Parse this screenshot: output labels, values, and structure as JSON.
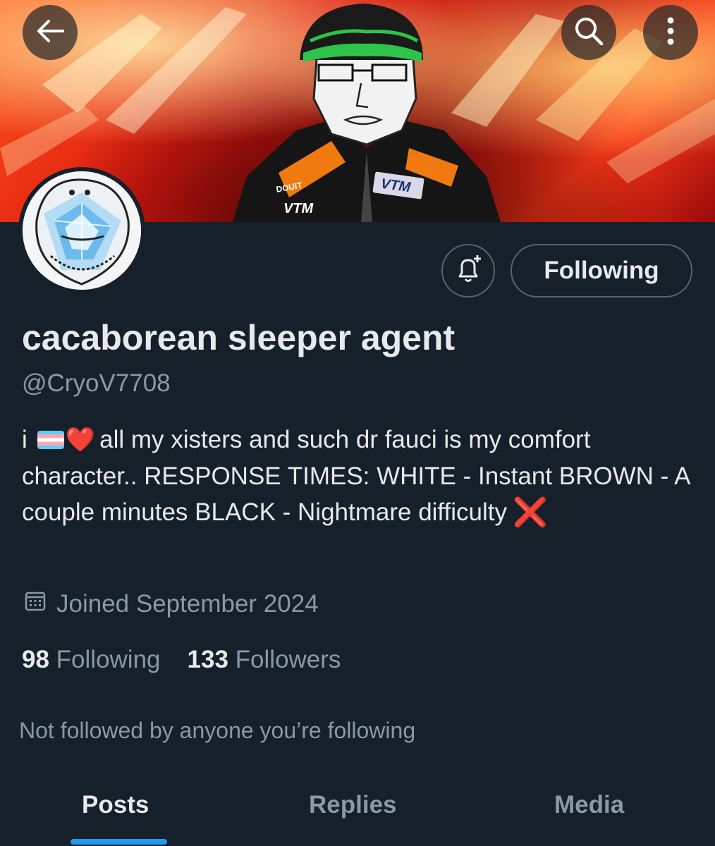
{
  "header": {
    "back_icon": "arrow-left-icon",
    "search_icon": "search-icon",
    "more_icon": "more-vertical-icon"
  },
  "banner": {
    "jacket_text_left": "VTM",
    "jacket_text_chest": "VTM",
    "jacket_text_sleeve": "DOUIT"
  },
  "actions": {
    "notify_icon": "bell-plus-icon",
    "follow_label": "Following"
  },
  "profile": {
    "display_name": "cacaborean sleeper agent",
    "handle": "@CryoV7708",
    "bio_start": "i",
    "bio_text": "all my xisters and such dr fauci is my comfort character.. RESPONSE TIMES:  WHITE - Instant BROWN - A couple minutes BLACK - Nightmare difficulty",
    "bio_emoji_heart": "❤️",
    "bio_emoji_cross": "❌",
    "joined_icon": "calendar-icon",
    "joined": "Joined September 2024"
  },
  "stats": {
    "following_count": "98",
    "following_label": "Following",
    "followers_count": "133",
    "followers_label": "Followers"
  },
  "mutuals_text": "Not followed by anyone you’re following",
  "tabs": [
    {
      "label": "Posts"
    },
    {
      "label": "Replies"
    },
    {
      "label": "Media"
    }
  ],
  "colors": {
    "background": "#15202b",
    "accent": "#1d9bf0",
    "secondary_text": "#8b98a5"
  }
}
